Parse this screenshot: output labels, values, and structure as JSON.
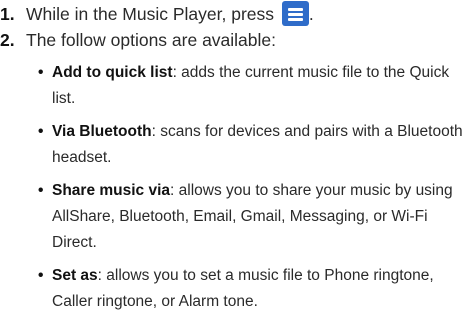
{
  "steps": [
    {
      "number": "1.",
      "text": "While in the Music Player, press",
      "after": "."
    },
    {
      "number": "2.",
      "text": "The follow options are available:"
    }
  ],
  "menu_icon": "menu-key-icon",
  "options": [
    {
      "term": "Add to quick list",
      "desc": ": adds the current music file to the Quick list."
    },
    {
      "term": "Via Bluetooth",
      "desc": ": scans for devices and pairs with a Bluetooth headset."
    },
    {
      "term": "Share music via",
      "desc": ": allows you to share your music by using AllShare, Bluetooth, Email, Gmail, Messaging, or Wi-Fi Direct."
    },
    {
      "term": "Set as",
      "desc": ": allows you to set a music file to Phone ringtone, Caller ringtone, or Alarm tone."
    }
  ],
  "colors": {
    "menu_key": "#2f6cc9"
  }
}
